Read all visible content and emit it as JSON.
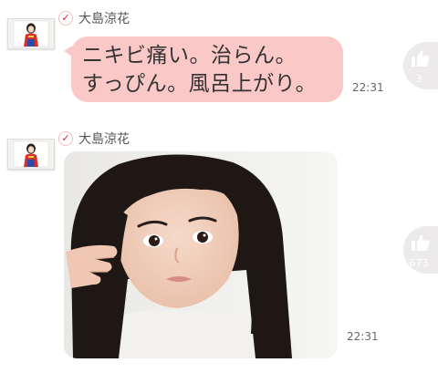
{
  "posts": [
    {
      "author": "大島涼花",
      "message_lines": [
        "ニキビ痛い。治らん。",
        "すっぴん。風呂上がり。"
      ],
      "time": "22:31",
      "likes": "3"
    },
    {
      "author": "大島涼花",
      "time": "22:31",
      "likes": "673"
    }
  ],
  "colors": {
    "bubble": "#fbc8c8",
    "like_button": "#eceaea",
    "verified_check": "#dd2233"
  },
  "icons": {
    "verified": "check-icon",
    "like": "thumbs-up-icon"
  }
}
